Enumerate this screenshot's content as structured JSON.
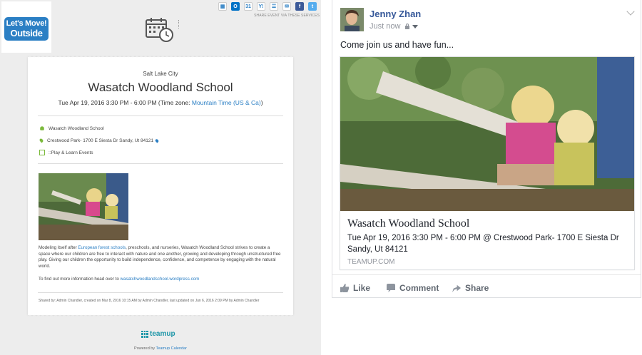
{
  "left": {
    "logo": {
      "line1": "Let's Move!",
      "line2": "Outside"
    },
    "share": {
      "label": "SHARE EVENT VIA THESE SERVICES",
      "icons": [
        "ical-icon",
        "outlook-icon",
        "google-calendar-icon",
        "yahoo-icon",
        "list-icon",
        "email-icon",
        "facebook-icon",
        "twitter-icon"
      ]
    },
    "event": {
      "city": "Salt Lake City",
      "title": "Wasatch Woodland School",
      "time_text": "Tue Apr 19, 2016 3:30 PM - 6:00 PM (Time zone: ",
      "time_zone": "Mountain Time (US & Ca)",
      "time_close": ")",
      "who": "Wasatch Woodland School",
      "where": "Crestwood Park- 1700 E Siesta Dr Sandy, Ut 84121",
      "calendar": "::Play & Learn Events",
      "desc_pre": "Modeling itself after ",
      "desc_link": "European forest schools",
      "desc_post": ", preschools, and nurseries, Wasatch Woodland School strives to create a space where our children are free to interact with nature and one another, growing and developing through unstructured free play. Giving our children the opportunity to build independence, confidence, and competence by engaging with the natural world.",
      "more_pre": "To find out more information head over to ",
      "more_link": "wasatchwoodlandschool.wordpress.com",
      "shared_by": "Shared by: Admin Chandler, created on Mar 8, 2016 10:15 AM by Admin Chandler, last updated on Jun 6, 2016 2:09 PM by Admin Chandler"
    },
    "footer": {
      "brand": "teamup",
      "powered_pre": "Powered by ",
      "powered_link": "Teamup Calendar"
    }
  },
  "right": {
    "user": "Jenny Zhan",
    "time": "Just now",
    "message": "Come join us and have fun...",
    "link": {
      "title": "Wasatch Woodland School",
      "desc": "Tue Apr 19, 2016 3:30 PM - 6:00 PM @ Crestwood Park- 1700 E Siesta Dr Sandy, Ut 84121",
      "domain": "TEAMUP.COM"
    },
    "actions": {
      "like": "Like",
      "comment": "Comment",
      "share": "Share"
    }
  },
  "colors": {
    "link": "#2b7fc4",
    "fb_name": "#365899",
    "accent_green": "#7cba3d",
    "teamup": "#1e96a8"
  }
}
